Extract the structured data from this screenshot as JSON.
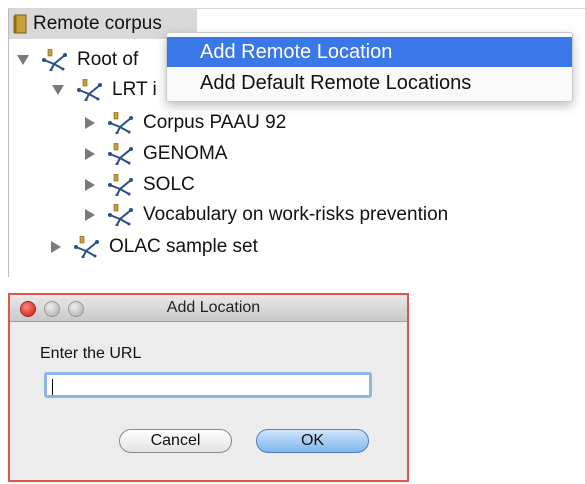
{
  "tree": {
    "root_label": "Remote corpus",
    "items": [
      {
        "label": "Root of",
        "expanded": true
      },
      {
        "label": "LRT i",
        "expanded": true
      },
      {
        "label": "Corpus PAAU 92",
        "expanded": false
      },
      {
        "label": "GENOMA",
        "expanded": false
      },
      {
        "label": "SOLC",
        "expanded": false
      },
      {
        "label": "Vocabulary on work-risks prevention",
        "expanded": false
      },
      {
        "label": "OLAC sample set",
        "expanded": false
      }
    ]
  },
  "context_menu": {
    "items": [
      {
        "label": "Add Remote Location",
        "highlighted": true
      },
      {
        "label": "Add Default Remote Locations",
        "highlighted": false
      }
    ]
  },
  "dialog": {
    "title": "Add Location",
    "prompt": "Enter the URL",
    "input_value": "",
    "cancel_label": "Cancel",
    "ok_label": "OK"
  },
  "colors": {
    "menu_highlight": "#3b78e7",
    "dialog_border": "#e0554e",
    "input_focus": "#8fb4e6"
  },
  "icons": {
    "root": "book-icon",
    "node": "corpus-network-icon"
  }
}
